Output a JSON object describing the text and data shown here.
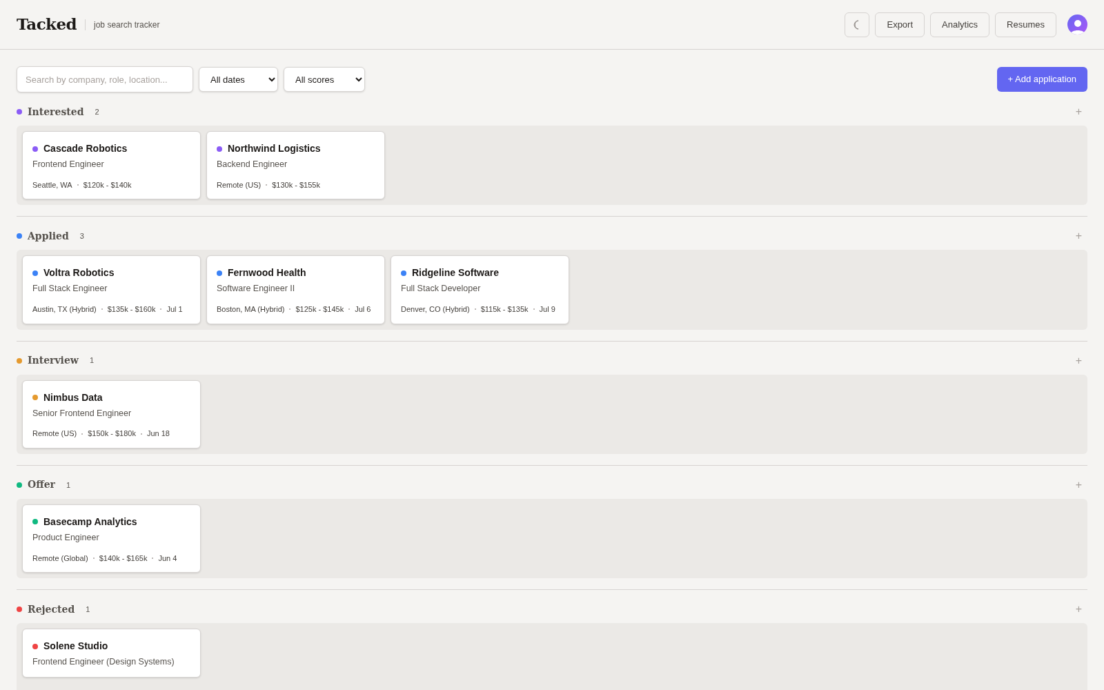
{
  "header": {
    "title": "Tacked",
    "subtitle": "job search tracker",
    "buttons": [
      "Export",
      "Analytics",
      "Resumes"
    ]
  },
  "toolbar": {
    "search": {
      "placeholder": "Search by company, role, location..."
    },
    "filters": [
      "All dates",
      "All scores"
    ],
    "add_button": "+ Add application"
  },
  "columns": [
    {
      "name": "Interested",
      "count": "2",
      "color": "#8b5cf6",
      "add": "+",
      "cards": [
        {
          "company": "Cascade Robotics",
          "role": "Frontend Engineer",
          "meta": [
            "Seattle, WA",
            "$120k - $140k"
          ]
        },
        {
          "company": "Northwind Logistics",
          "role": "Backend Engineer",
          "meta": [
            "Remote (US)",
            "$130k - $155k"
          ]
        }
      ]
    },
    {
      "name": "Applied",
      "count": "3",
      "color": "#3b82f6",
      "add": "+",
      "cards": [
        {
          "company": "Voltra Robotics",
          "role": "Full Stack Engineer",
          "meta": [
            "Austin, TX (Hybrid)",
            "$135k - $160k",
            "Jul 1"
          ]
        },
        {
          "company": "Fernwood Health",
          "role": "Software Engineer II",
          "meta": [
            "Boston, MA (Hybrid)",
            "$125k - $145k",
            "Jul 6"
          ]
        },
        {
          "company": "Ridgeline Software",
          "role": "Full Stack Developer",
          "meta": [
            "Denver, CO (Hybrid)",
            "$115k - $135k",
            "Jul 9"
          ]
        }
      ]
    },
    {
      "name": "Interview",
      "count": "1",
      "color": "#e59a2f",
      "add": "+",
      "cards": [
        {
          "company": "Nimbus Data",
          "role": "Senior Frontend Engineer",
          "meta": [
            "Remote (US)",
            "$150k - $180k",
            "Jun 18"
          ]
        }
      ]
    },
    {
      "name": "Offer",
      "count": "1",
      "color": "#10b981",
      "add": "+",
      "cards": [
        {
          "company": "Basecamp Analytics",
          "role": "Product Engineer",
          "meta": [
            "Remote (Global)",
            "$140k - $165k",
            "Jun 4"
          ]
        }
      ]
    },
    {
      "name": "Rejected",
      "count": "1",
      "color": "#ef4444",
      "add": "+",
      "cards": [
        {
          "company": "Solene Studio",
          "role": "Frontend Engineer (Design Systems)"
        }
      ]
    }
  ]
}
